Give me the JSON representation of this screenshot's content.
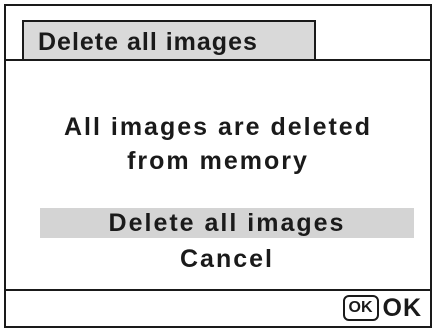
{
  "dialog": {
    "title": "Delete all images",
    "message_line1": "All images are deleted",
    "message_line2": "from memory"
  },
  "menu": {
    "options": [
      {
        "label": "Delete all images",
        "selected": true
      },
      {
        "label": "Cancel",
        "selected": false
      }
    ]
  },
  "footer": {
    "key_label": "OK",
    "action_label": "OK"
  },
  "colors": {
    "highlight": "#d4d4d4",
    "title_background": "#d9d9d9",
    "border": "#1a1a1a"
  }
}
